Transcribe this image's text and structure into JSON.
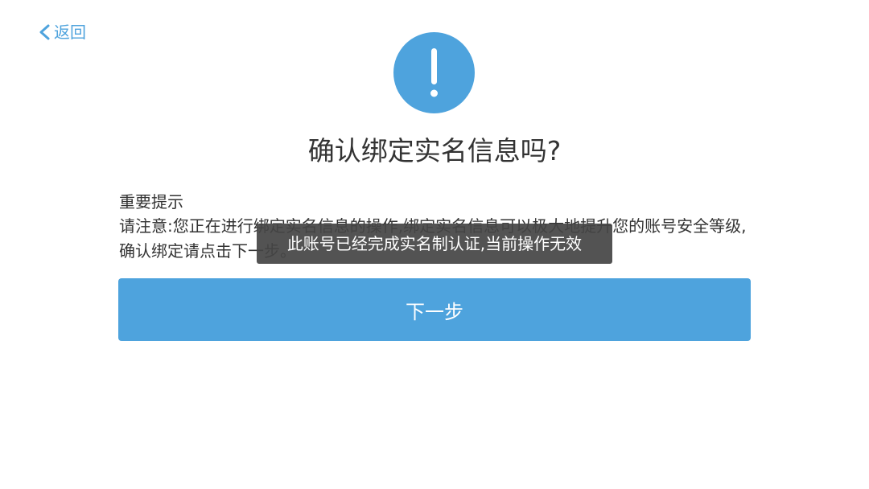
{
  "header": {
    "back_label": "返回"
  },
  "dialog": {
    "alert_icon": "exclamation-icon",
    "title": "确认绑定实名信息吗?",
    "notice_heading": "重要提示",
    "notice_body": "请注意:您正在进行绑定实名信息的操作,绑定实名信息可以极大地提升您的账号安全等级,确认绑定请点击下一步。",
    "next_button_label": "下一步"
  },
  "toast": {
    "message": "此账号已经完成实名制认证,当前操作无效"
  },
  "colors": {
    "accent": "#4ea3dd",
    "text": "#333333",
    "toast_bg": "#444444"
  }
}
